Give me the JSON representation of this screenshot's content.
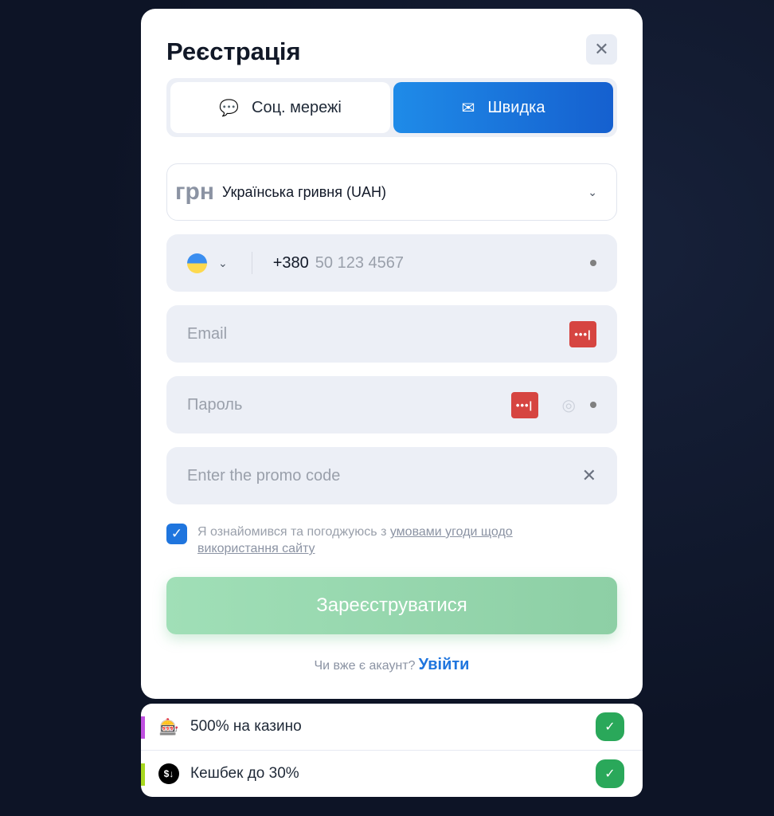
{
  "modal": {
    "title": "Реєстрація",
    "close_icon": "close-icon",
    "tabs": [
      {
        "label": "Соц. мережі",
        "icon": "chat-bubble-icon"
      },
      {
        "label": "Швидка",
        "icon": "envelope-icon",
        "active": true
      }
    ],
    "currency": {
      "symbol": "грн",
      "value": "Українська гривня (UAH)"
    },
    "phone": {
      "country": "Ukraine",
      "code": "+380",
      "placeholder": "50 123 4567"
    },
    "email": {
      "placeholder": "Email"
    },
    "password": {
      "placeholder": "Пароль"
    },
    "promo": {
      "placeholder": "Enter the promo code"
    },
    "agree": {
      "checked": true,
      "text": "Я ознайомився та погоджуюсь з ",
      "link": "умовами угоди щодо використання сайту"
    },
    "submit_label": "Зареєструватися",
    "login": {
      "prompt": "Чи вже є акаунт?",
      "link": "Увійти"
    },
    "colors": {
      "accent": "#1f75de",
      "submit": "#96d7ae",
      "check": "#2aa85a"
    }
  },
  "bonuses": [
    {
      "label": "500% на казино",
      "icon": "slot-machine-icon",
      "bar": "#c050e0"
    },
    {
      "label": "Кешбек до 30%",
      "icon": "cashback-coin-icon",
      "bar": "#a8d820"
    }
  ]
}
